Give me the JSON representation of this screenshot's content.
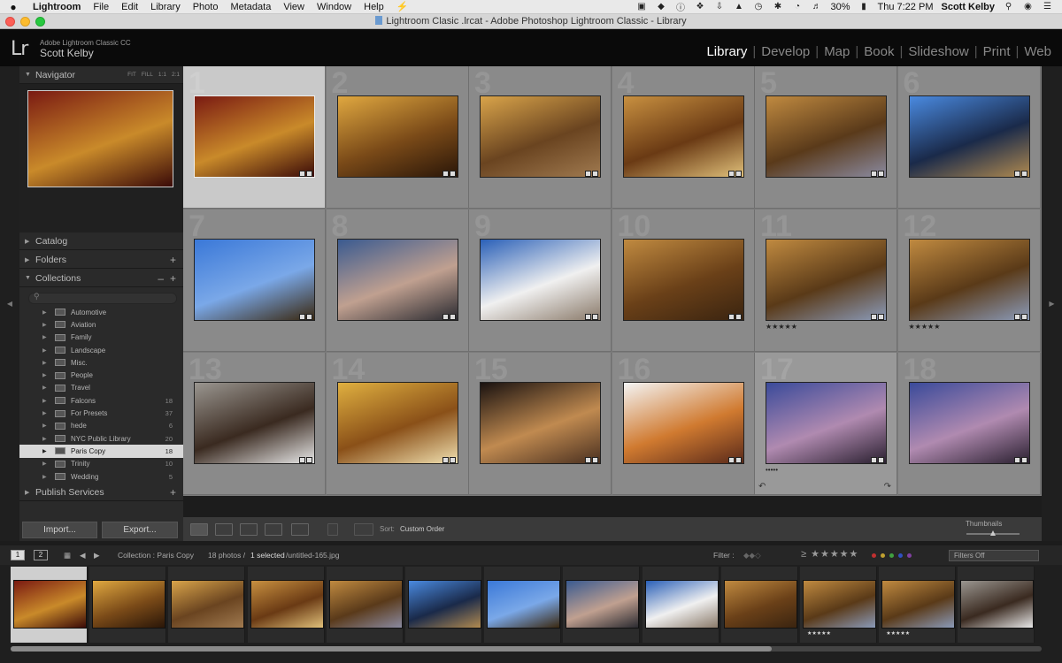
{
  "menubar": {
    "items": [
      "Lightroom",
      "File",
      "Edit",
      "Library",
      "Photo",
      "Metadata",
      "View",
      "Window",
      "Help"
    ],
    "battery": "30%",
    "clock": "Thu 7:22 PM",
    "user": "Scott Kelby"
  },
  "window": {
    "title": "Lightroom Clasic .lrcat - Adobe Photoshop Lightroom Classic - Library"
  },
  "identity": {
    "app_name": "Adobe Lightroom Classic CC",
    "user_name": "Scott Kelby"
  },
  "modules": [
    "Library",
    "Develop",
    "Map",
    "Book",
    "Slideshow",
    "Print",
    "Web"
  ],
  "active_module": "Library",
  "left_panel": {
    "navigator": {
      "label": "Navigator",
      "zoom": [
        "FIT",
        "FILL",
        "1:1",
        "2:1"
      ]
    },
    "catalog_label": "Catalog",
    "folders_label": "Folders",
    "collections_label": "Collections",
    "publish_label": "Publish Services",
    "collections": [
      {
        "name": "Automotive",
        "count": ""
      },
      {
        "name": "Aviation",
        "count": ""
      },
      {
        "name": "Family",
        "count": ""
      },
      {
        "name": "Landscape",
        "count": ""
      },
      {
        "name": "Misc.",
        "count": ""
      },
      {
        "name": "People",
        "count": ""
      },
      {
        "name": "Travel",
        "count": ""
      },
      {
        "name": "Falcons",
        "count": "18"
      },
      {
        "name": "For Presets",
        "count": "37"
      },
      {
        "name": "hede",
        "count": "6"
      },
      {
        "name": "NYC Public Library",
        "count": "20"
      },
      {
        "name": "Paris Copy",
        "count": "18",
        "selected": true
      },
      {
        "name": "Trinity",
        "count": "10"
      },
      {
        "name": "Wedding",
        "count": "5"
      }
    ],
    "import_label": "Import...",
    "export_label": "Export..."
  },
  "grid": {
    "cells": [
      {
        "num": "1",
        "colors": [
          "#7a1a12",
          "#c98a2a",
          "#3a0a08"
        ],
        "selected": true,
        "stars": ""
      },
      {
        "num": "2",
        "colors": [
          "#e0a840",
          "#7a4a18",
          "#2a1608"
        ],
        "stars": ""
      },
      {
        "num": "3",
        "colors": [
          "#d9a44a",
          "#6a4420",
          "#a07a50"
        ],
        "stars": ""
      },
      {
        "num": "4",
        "colors": [
          "#c89040",
          "#6a3a14",
          "#e0c07a"
        ],
        "stars": ""
      },
      {
        "num": "5",
        "colors": [
          "#c08a40",
          "#5a3a1a",
          "#8a8aa0"
        ],
        "stars": ""
      },
      {
        "num": "6",
        "colors": [
          "#4a8ae0",
          "#1a2a4a",
          "#b08a50"
        ],
        "stars": ""
      },
      {
        "num": "7",
        "colors": [
          "#3a78d8",
          "#7aa8e8",
          "#3a2810"
        ],
        "stars": ""
      },
      {
        "num": "8",
        "colors": [
          "#3a5a90",
          "#c0a090",
          "#2a2a30"
        ],
        "stars": ""
      },
      {
        "num": "9",
        "colors": [
          "#2a60b8",
          "#f0f0f0",
          "#8a7a6a"
        ],
        "stars": ""
      },
      {
        "num": "10",
        "colors": [
          "#c08a40",
          "#6a4018",
          "#3a2410"
        ],
        "stars": ""
      },
      {
        "num": "11",
        "colors": [
          "#c08a40",
          "#5a3a18",
          "#8a9ab8"
        ],
        "stars": "★★★★★"
      },
      {
        "num": "12",
        "colors": [
          "#c08a40",
          "#5a3a18",
          "#8a9ab8"
        ],
        "stars": "★★★★★"
      },
      {
        "num": "13",
        "colors": [
          "#9a9690",
          "#3a2a20",
          "#e8e8e8"
        ],
        "stars": ""
      },
      {
        "num": "14",
        "colors": [
          "#e0b040",
          "#8a5018",
          "#f0e0b0"
        ],
        "stars": ""
      },
      {
        "num": "15",
        "colors": [
          "#1a1210",
          "#c08a50",
          "#4a3020"
        ],
        "stars": ""
      },
      {
        "num": "16",
        "colors": [
          "#f4f4f4",
          "#d07a30",
          "#5a2a1a"
        ],
        "stars": ""
      },
      {
        "num": "17",
        "colors": [
          "#3a4a9a",
          "#b08ab0",
          "#2a2030"
        ],
        "stars": "•••••"
      },
      {
        "num": "18",
        "colors": [
          "#3a4a9a",
          "#b08ab0",
          "#2a2030"
        ],
        "stars": ""
      }
    ]
  },
  "toolbar": {
    "sort_label": "Sort:",
    "sort_value": "Custom Order",
    "thumbnails_label": "Thumbnails"
  },
  "filmstrip_header": {
    "pages": [
      "1",
      "2"
    ],
    "source": "Collection : Paris Copy",
    "photo_count": "18 photos /",
    "selected": "1 selected",
    "filename": "/untitled-165.jpg",
    "filter_label": "Filter :",
    "filter_value": "Filters Off",
    "label_colors": [
      "#c03030",
      "#c0a030",
      "#40a040",
      "#3050c0",
      "#8040a0"
    ]
  },
  "filmstrip": {
    "thumbs": [
      0,
      1,
      2,
      3,
      4,
      5,
      6,
      7,
      8,
      9,
      10,
      11,
      12
    ]
  }
}
